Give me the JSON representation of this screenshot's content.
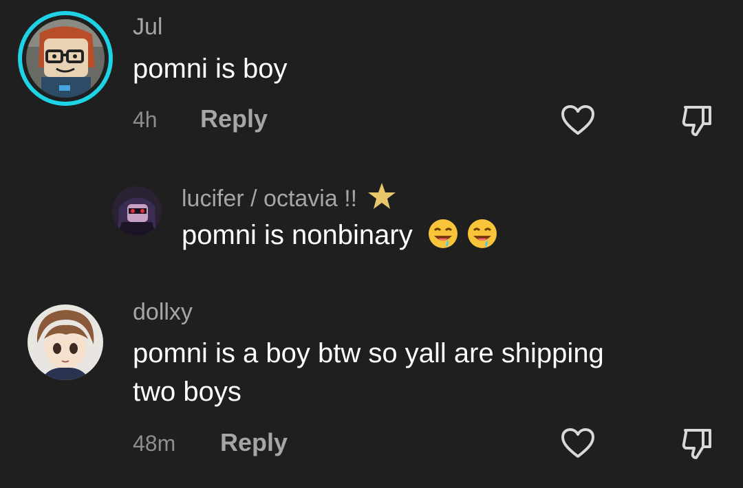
{
  "comments": [
    {
      "username": "Jul",
      "text": "pomni is boy",
      "time": "4h",
      "reply_label": "Reply",
      "avatar_icon": "roblox-avatar-with-story-ring"
    },
    {
      "username": "lucifer / octavia !!",
      "badge_icon": "star-icon",
      "text": "pomni is nonbinary",
      "emoji": [
        "drooling-face-emoji",
        "drooling-face-emoji"
      ],
      "avatar_icon": "dark-character-avatar"
    },
    {
      "username": "dollxy",
      "text_line1": "pomni is a boy btw so yall are shipping",
      "text_line2": "two boys",
      "time": "48m",
      "reply_label": "Reply",
      "avatar_icon": "anime-boy-avatar"
    }
  ],
  "colors": {
    "background": "#1f1f1f",
    "username": "#a6a6a6",
    "text": "#ffffff",
    "story_ring": "#20d5ec",
    "star": "#e8c66a"
  }
}
